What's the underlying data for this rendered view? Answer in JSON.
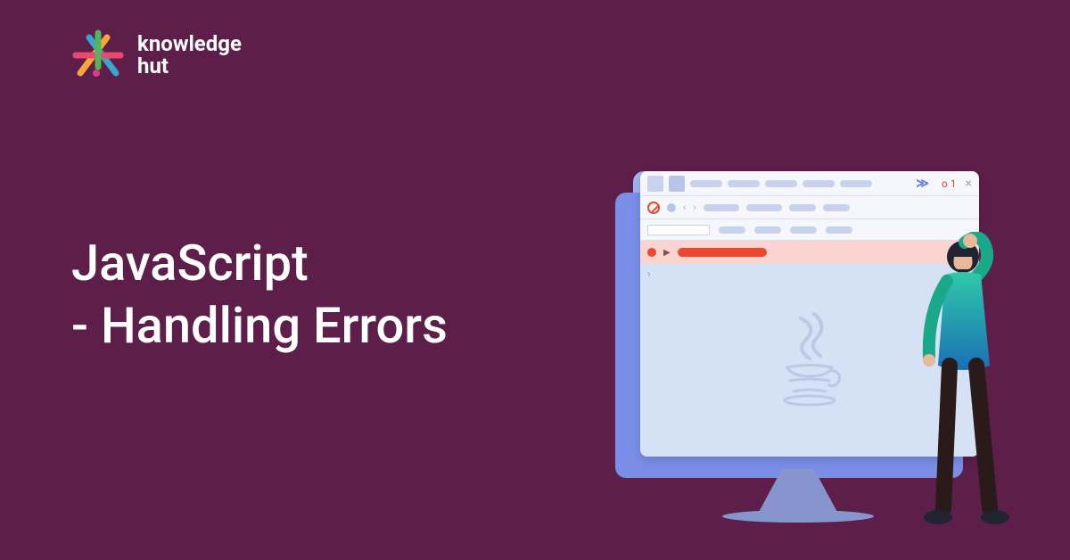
{
  "brand": {
    "line1": "knowledge",
    "line2": "hut"
  },
  "title": {
    "line1": "JavaScript",
    "line2": "- Handling Errors"
  },
  "toolbar": {
    "error_badge": "o 1",
    "chevrons": "≫"
  },
  "colors": {
    "background": "#5e1e4a",
    "accent_red": "#e84a2f",
    "accent_blue": "#5b7de6"
  }
}
